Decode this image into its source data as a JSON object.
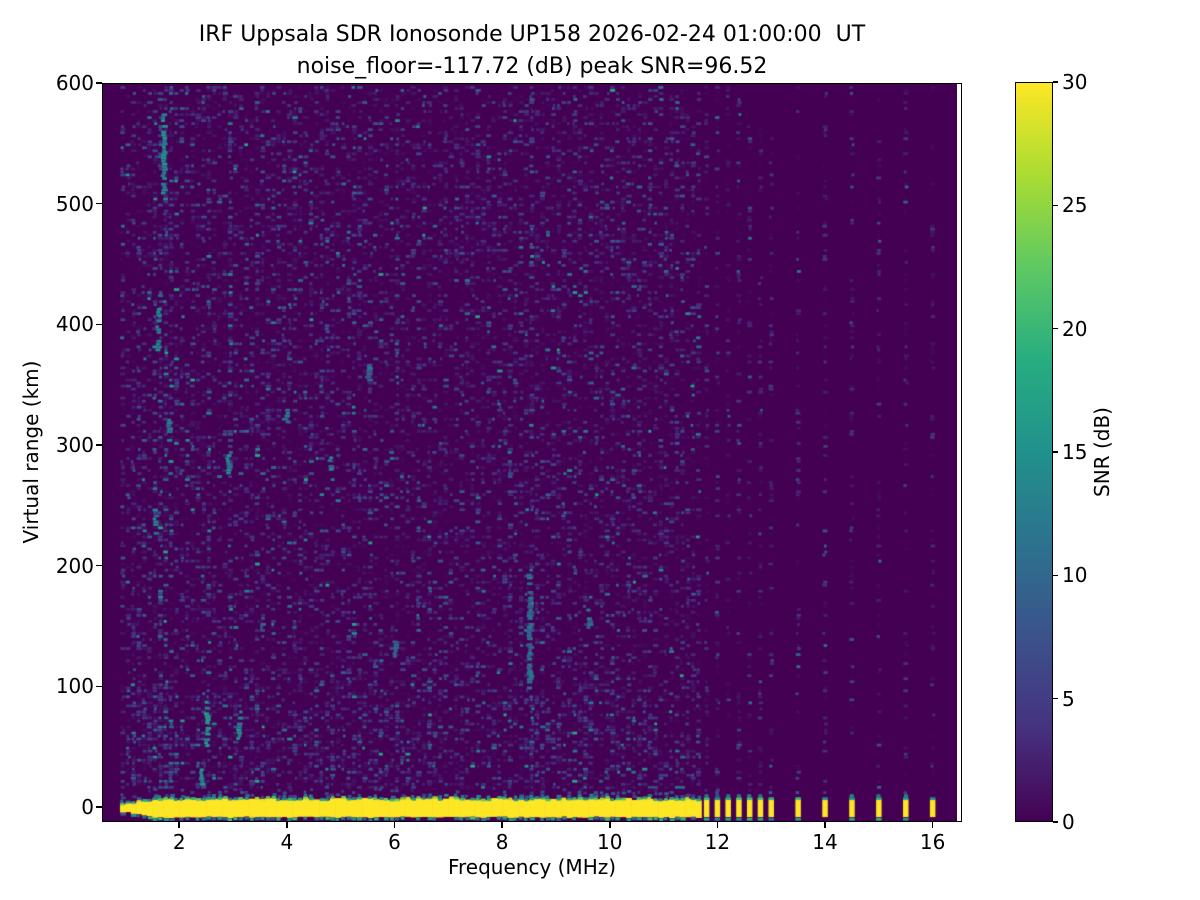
{
  "figure": {
    "title": "IRF Uppsala SDR Ionosonde UP158 2026-02-24 01:00:00  UT",
    "subtitle": "noise_floor=-117.72 (dB) peak SNR=96.52",
    "station": "UP158",
    "timestamp_ut": "2026-02-24 01:00:00"
  },
  "chart_data": {
    "type": "heatmap",
    "title": "IRF Uppsala SDR Ionosonde UP158 2026-02-24 01:00:00  UT",
    "subtitle": "noise_floor=-117.72 (dB) peak SNR=96.52",
    "xlabel": "Frequency (MHz)",
    "ylabel": "Virtual range (km)",
    "x_ticks": [
      2,
      4,
      6,
      8,
      10,
      12,
      14,
      16
    ],
    "y_ticks": [
      0,
      100,
      200,
      300,
      400,
      500,
      600
    ],
    "xlim": [
      0.565,
      16.545
    ],
    "ylim": [
      -12.4,
      600
    ],
    "grid": false,
    "legend": "none",
    "noise_floor_db": -117.72,
    "peak_snr_db": 96.52,
    "colorbar": {
      "label": "SNR (dB)",
      "ticks": [
        0,
        5,
        10,
        15,
        20,
        25,
        30
      ],
      "range": [
        0,
        30
      ],
      "colormap": "viridis",
      "stops": [
        [
          0.0,
          "#440154"
        ],
        [
          0.125,
          "#46327e"
        ],
        [
          0.25,
          "#3b528b"
        ],
        [
          0.375,
          "#2c728e"
        ],
        [
          0.5,
          "#21918c"
        ],
        [
          0.625,
          "#27ad81"
        ],
        [
          0.75,
          "#5ec962"
        ],
        [
          0.875,
          "#aadc32"
        ],
        [
          1.0,
          "#fde725"
        ]
      ]
    },
    "sweep": {
      "f_start_mhz": 0.9,
      "f_end_mhz": 11.6,
      "f_step_mhz": 0.1
    },
    "discrete_freqs_mhz": [
      11.8,
      12.0,
      12.2,
      12.4,
      12.6,
      12.8,
      13.0,
      13.5,
      14.0,
      14.5,
      15.0,
      15.5,
      16.0
    ],
    "ground_band": {
      "center_km": 0,
      "top_km": 6.5,
      "bottom_km": -8.5,
      "snr_db": 30,
      "taper_start_mhz": 0.9,
      "taper_width_mhz": 0.6,
      "fringe_top_km": 13,
      "fringe_bottom_km": -10.5
    },
    "noise": {
      "seed": 1337,
      "density": 0.38,
      "mean_db": 2.8,
      "low_alt_boost_below_km": 100,
      "row_step_km": 2.5,
      "discrete_col_density": 0.27,
      "discrete_col_mean_db": 2.2
    },
    "interference_stripes": [
      {
        "f": 1.5,
        "d": 1.25,
        "b": 1.2
      },
      {
        "f": 1.6,
        "d": 1.35,
        "b": 1.3
      },
      {
        "f": 1.7,
        "d": 1.5,
        "b": 1.5
      },
      {
        "f": 1.8,
        "d": 1.3,
        "b": 1.25
      },
      {
        "f": 2.5,
        "d": 1.3,
        "b": 1.35
      },
      {
        "f": 2.9,
        "d": 1.2,
        "b": 1.3
      },
      {
        "f": 3.4,
        "d": 1.2,
        "b": 1.2
      },
      {
        "f": 4.6,
        "d": 1.15,
        "b": 1.15
      },
      {
        "f": 6.0,
        "d": 1.3,
        "b": 1.15
      },
      {
        "f": 8.5,
        "d": 1.45,
        "b": 1.3
      },
      {
        "f": 9.3,
        "d": 1.2,
        "b": 1.1
      }
    ],
    "echo_features": [
      {
        "f": 1.7,
        "km0": 510,
        "km1": 575,
        "snr": 14
      },
      {
        "f": 1.6,
        "km0": 380,
        "km1": 415,
        "snr": 13
      },
      {
        "f": 1.55,
        "km0": 228,
        "km1": 248,
        "snr": 12
      },
      {
        "f": 1.8,
        "km0": 305,
        "km1": 322,
        "snr": 13
      },
      {
        "f": 2.5,
        "km0": 52,
        "km1": 90,
        "snr": 15
      },
      {
        "f": 2.4,
        "km0": 20,
        "km1": 32,
        "snr": 14
      },
      {
        "f": 2.9,
        "km0": 278,
        "km1": 296,
        "snr": 14
      },
      {
        "f": 3.1,
        "km0": 58,
        "km1": 76,
        "snr": 13
      },
      {
        "f": 4.8,
        "km0": 281,
        "km1": 294,
        "snr": 12
      },
      {
        "f": 4.0,
        "km0": 318,
        "km1": 332,
        "snr": 11
      },
      {
        "f": 6.0,
        "km0": 126,
        "km1": 140,
        "snr": 11
      },
      {
        "f": 8.5,
        "km0": 95,
        "km1": 195,
        "snr": 10
      },
      {
        "f": 9.6,
        "km0": 150,
        "km1": 165,
        "snr": 10
      },
      {
        "f": 5.5,
        "km0": 355,
        "km1": 368,
        "snr": 10
      }
    ]
  }
}
